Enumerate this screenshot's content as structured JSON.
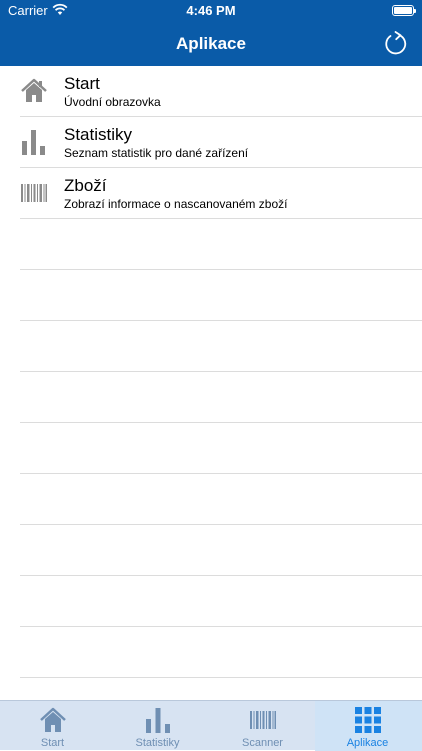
{
  "status": {
    "carrier": "Carrier",
    "time": "4:46 PM"
  },
  "nav": {
    "title": "Aplikace"
  },
  "list": [
    {
      "title": "Start",
      "subtitle": "Úvodní obrazovka",
      "icon": "home-icon"
    },
    {
      "title": "Statistiky",
      "subtitle": "Seznam statistik pro dané zařízení",
      "icon": "bar-chart-icon"
    },
    {
      "title": "Zboží",
      "subtitle": "Zobrazí informace o nascanovaném zboží",
      "icon": "barcode-icon"
    }
  ],
  "tabs": [
    {
      "label": "Start",
      "icon": "home-icon"
    },
    {
      "label": "Statistiky",
      "icon": "bar-chart-icon"
    },
    {
      "label": "Scanner",
      "icon": "barcode-icon"
    },
    {
      "label": "Aplikace",
      "icon": "grid-icon",
      "active": true
    }
  ],
  "colors": {
    "nav_bg": "#0a5ba8",
    "tab_bg": "#d7e3f2",
    "tab_active": "#1a82e2",
    "tab_inactive": "#6f8fb3",
    "list_icon": "#8a8a8a"
  }
}
